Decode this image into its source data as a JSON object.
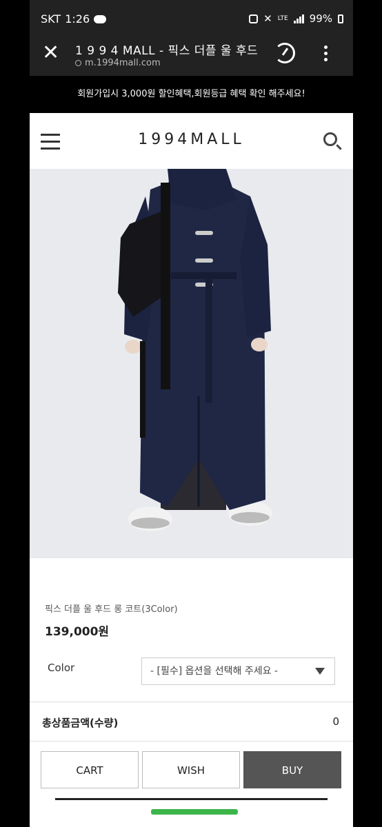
{
  "status_bar": {
    "carrier": "SKT",
    "time": "1:26",
    "network": "LTE",
    "battery": "99%"
  },
  "browser": {
    "title": "1 9 9 4 MALL - 픽스 더플 울 후드",
    "url": "m.1994mall.com",
    "close_icon": "close-icon",
    "menu_icon": "kebab-icon"
  },
  "promo": {
    "text": "회원가입시 3,000원 할인혜택,회원등급 혜택 확인 해주세요!"
  },
  "site_header": {
    "logo": "1994MALL"
  },
  "product": {
    "name": "픽스 더플 울 후드 롱 코트(3Color)",
    "price": "139,000원",
    "option_label": "Color",
    "option_placeholder": "- [필수] 옵션을 선택해 주세요 -",
    "total_label": "총상품금액(수량)",
    "total_value": "0"
  },
  "actions": {
    "cart": "CART",
    "wish": "WISH",
    "buy": "BUY"
  },
  "colors": {
    "buy_bg": "#555555",
    "coat": "#1f2745",
    "accent_green": "#3cb54a"
  }
}
